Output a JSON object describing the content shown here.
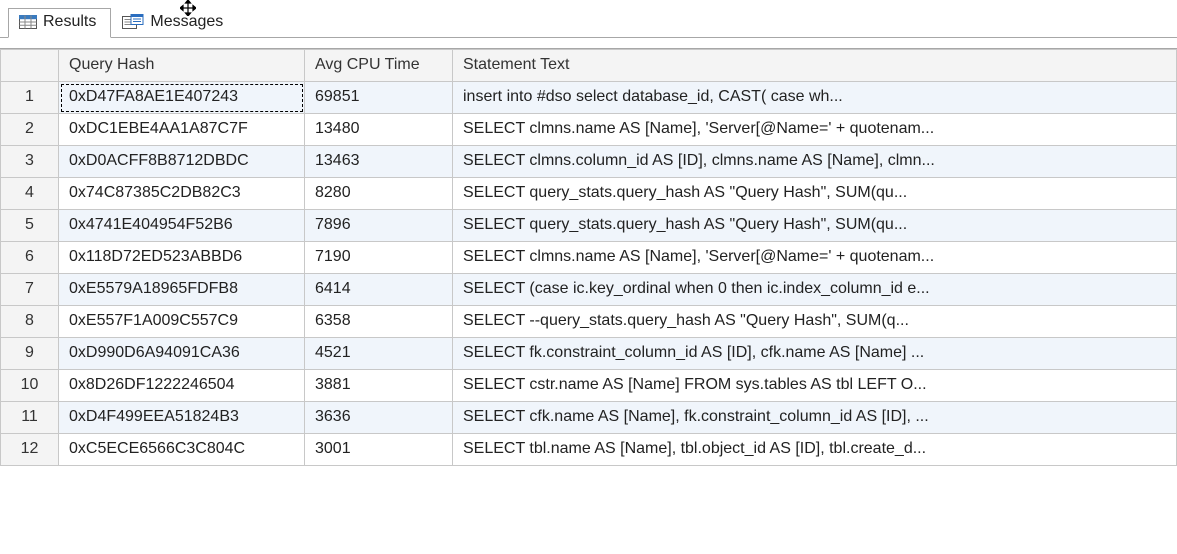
{
  "tabs": {
    "results_label": "Results",
    "messages_label": "Messages"
  },
  "columns": {
    "query_hash": "Query Hash",
    "avg_cpu": "Avg CPU Time",
    "statement": "Statement Text"
  },
  "rows": [
    {
      "n": "1",
      "hash": "0xD47FA8AE1E407243",
      "cpu": "69851",
      "stmt": "insert into #dso select database_id, CAST(       case         wh..."
    },
    {
      "n": "2",
      "hash": "0xDC1EBE4AA1A87C7F",
      "cpu": "13480",
      "stmt": "SELECT clmns.name AS [Name], 'Server[@Name=' + quotenam..."
    },
    {
      "n": "3",
      "hash": "0xD0ACFF8B8712DBDC",
      "cpu": "13463",
      "stmt": "SELECT clmns.column_id AS [ID], clmns.name AS [Name], clmn..."
    },
    {
      "n": "4",
      "hash": "0x74C87385C2DB82C3",
      "cpu": "8280",
      "stmt": "SELECT query_stats.query_hash AS \"Query Hash\",      SUM(qu..."
    },
    {
      "n": "5",
      "hash": "0x4741E404954F52B6",
      "cpu": "7896",
      "stmt": "SELECT query_stats.query_hash AS \"Query Hash\",      SUM(qu..."
    },
    {
      "n": "6",
      "hash": "0x118D72ED523ABBD6",
      "cpu": "7190",
      "stmt": "SELECT clmns.name AS [Name], 'Server[@Name=' + quotenam..."
    },
    {
      "n": "7",
      "hash": "0xE5579A18965FDFB8",
      "cpu": "6414",
      "stmt": "SELECT (case ic.key_ordinal when 0 then ic.index_column_id e..."
    },
    {
      "n": "8",
      "hash": "0xE557F1A009C557C9",
      "cpu": "6358",
      "stmt": "SELECT --query_stats.query_hash AS \"Query Hash\",      SUM(q..."
    },
    {
      "n": "9",
      "hash": "0xD990D6A94091CA36",
      "cpu": "4521",
      "stmt": "SELECT fk.constraint_column_id AS [ID], cfk.name AS [Name] ..."
    },
    {
      "n": "10",
      "hash": "0x8D26DF1222246504",
      "cpu": "3881",
      "stmt": "SELECT cstr.name AS [Name] FROM sys.tables AS tbl LEFT O..."
    },
    {
      "n": "11",
      "hash": "0xD4F499EEA51824B3",
      "cpu": "3636",
      "stmt": "SELECT cfk.name AS [Name], fk.constraint_column_id AS [ID], ..."
    },
    {
      "n": "12",
      "hash": "0xC5ECE6566C3C804C",
      "cpu": "3001",
      "stmt": "SELECT tbl.name AS [Name], tbl.object_id AS [ID], tbl.create_d..."
    }
  ]
}
